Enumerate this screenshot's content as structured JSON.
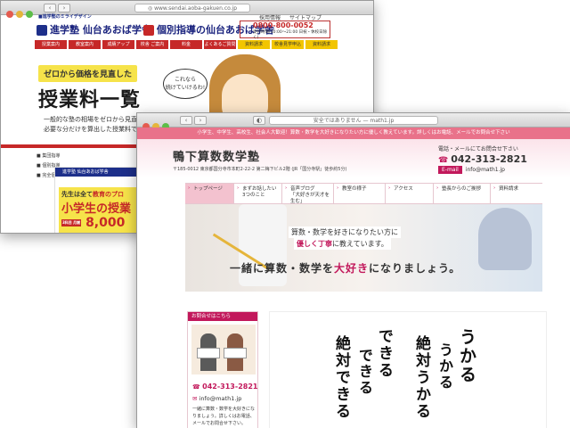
{
  "back_window": {
    "url": "◎ www.sendai.aoba-gakuen.co.jp",
    "top_small": "■進学塾のミライデザイン",
    "top_links": [
      "採用情報",
      "サイトマップ"
    ],
    "brand1": "進学塾 仙台あおば学舎",
    "brand2": "個別指導の仙台あおば学舎",
    "phone": "0800-800-0052",
    "phone_note": "受付時間(10:00〜21:00 日祝・休校日除く)",
    "nav": [
      "授業案内",
      "教室案内",
      "成績アップ",
      "校舎 ご案内",
      "料金",
      "よくあるご質問",
      "資料請求",
      "校舎見学申込",
      "資料請求"
    ],
    "badge": "ゼロから価格を見直した",
    "heading": "授業料一覧",
    "para": [
      "一般的な塾の相場をゼロから見直し",
      "必要な分だけを算出した授業料で"
    ],
    "bubble": [
      "これなら",
      "続けていけるわ!"
    ],
    "list": [
      "■ 集団指導",
      "■ 個別指導",
      "■ 完全個別"
    ],
    "card_header": "進学塾 仙台あおば学舎",
    "card_line1": "先生は全て",
    "card_line1_em": "教育のプロ",
    "card_line2": "小学生の授業",
    "card_tag": "3科目 月謝",
    "card_price": "8,000"
  },
  "front_window": {
    "url": "安全ではありません — math1.jp",
    "strip": "小学生、中学生、高校生、社会人大歓迎！算数・数学を大好きになりたい方に優しく教えています。詳しくはお電話、メールでお問合せ下さい",
    "title": "鴨下算数数学塾",
    "address": "〒185-0012 東京都国分寺市本町2-22-2 第二梅下ビル2階 (JR「国分寺駅」徒歩約5分)",
    "contact_label": "電話・メールにてお問合せ下さい",
    "phone": "042-313-2821",
    "email_tag": "E-mail",
    "email": "info@math1.jp",
    "nav": [
      "トップページ",
      "まずお話したい\n3つのこと",
      "音声ブログ\n「大好きが天才を\n生む」",
      "教室の様子",
      "アクセス",
      "塾長からのご挨拶",
      "資料請求"
    ],
    "hero_line1_pre": "算数・数学を好きになりたい方",
    "hero_line1_post": "に",
    "hero_line2_em": "優しく丁寧",
    "hero_line2_post": "に教えています。",
    "hero_big_pre": "一緒に算数・数学を",
    "hero_big_em": "大好き",
    "hero_big_post": "になりましょう。",
    "sidebox_header": "お問合せはこちら",
    "side_phone": "042-313-2821",
    "side_mail": "info@math1.jp",
    "side_text": "一緒に算数・数学を大好きになりましょう。詳しくはお電話、メールでお問合せ下さい。",
    "calligraphy": [
      "うかる",
      "うかる",
      "絶対うかる",
      "できる",
      "できる",
      "絶対できる"
    ]
  },
  "colors": {
    "accent": "#c2185b",
    "strip": "#e9728a",
    "back_red": "#c62828",
    "back_navy": "#1d2f8a"
  }
}
